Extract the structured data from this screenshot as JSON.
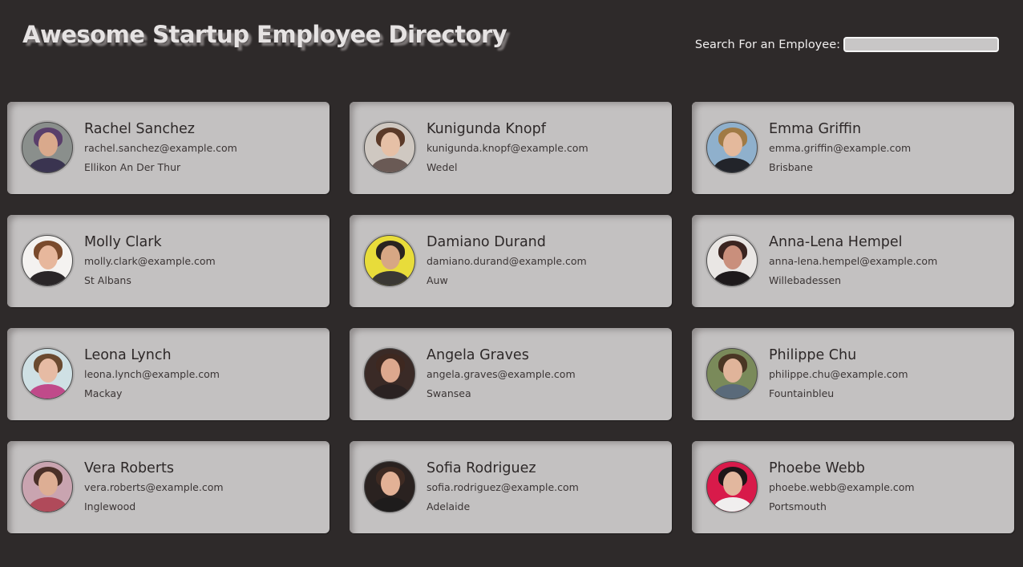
{
  "header": {
    "title": "Awesome Startup Employee Directory",
    "search_label": "Search For an Employee:",
    "search_value": "",
    "search_placeholder": ""
  },
  "employees": [
    {
      "name": "Rachel Sanchez",
      "email": "rachel.sanchez@example.com",
      "city": "Ellikon An Der Thur",
      "avatar": {
        "bg": "#8a8f8c",
        "hair": "#5a3f6b",
        "skin": "#d9a98c",
        "shirt": "#3a3450"
      }
    },
    {
      "name": "Kunigunda Knopf",
      "email": "kunigunda.knopf@example.com",
      "city": "Wedel",
      "avatar": {
        "bg": "#cfc8c1",
        "hair": "#5b3a28",
        "skin": "#e6c0a6",
        "shirt": "#6a5a55"
      }
    },
    {
      "name": "Emma Griffin",
      "email": "emma.griffin@example.com",
      "city": "Brisbane",
      "avatar": {
        "bg": "#8fb0cc",
        "hair": "#a07a45",
        "skin": "#e4b99c",
        "shirt": "#22242a"
      }
    },
    {
      "name": "Molly Clark",
      "email": "molly.clark@example.com",
      "city": "St Albans",
      "avatar": {
        "bg": "#f4f2f0",
        "hair": "#7a4a2c",
        "skin": "#e7b79c",
        "shirt": "#2a2628"
      }
    },
    {
      "name": "Damiano Durand",
      "email": "damiano.durand@example.com",
      "city": "Auw",
      "avatar": {
        "bg": "#e8dc3a",
        "hair": "#2a2420",
        "skin": "#d7a784",
        "shirt": "#3a3834"
      }
    },
    {
      "name": "Anna-Lena Hempel",
      "email": "anna-lena.hempel@example.com",
      "city": "Willebadessen",
      "avatar": {
        "bg": "#e9e6e4",
        "hair": "#3a2420",
        "skin": "#c98f7c",
        "shirt": "#1e1a1c"
      }
    },
    {
      "name": "Leona Lynch",
      "email": "leona.lynch@example.com",
      "city": "Mackay",
      "avatar": {
        "bg": "#cfe0e4",
        "hair": "#6a4a30",
        "skin": "#e6bba4",
        "shirt": "#c04a8a"
      }
    },
    {
      "name": "Angela Graves",
      "email": "angela.graves@example.com",
      "city": "Swansea",
      "avatar": {
        "bg": "#3a2a26",
        "hair": "#3e2820",
        "skin": "#dca88e",
        "shirt": "#2a2222"
      }
    },
    {
      "name": "Philippe Chu",
      "email": "philippe.chu@example.com",
      "city": "Fountainbleu",
      "avatar": {
        "bg": "#7a8a5a",
        "hair": "#4a3624",
        "skin": "#e0b49a",
        "shirt": "#5a6a7a"
      }
    },
    {
      "name": "Vera Roberts",
      "email": "vera.roberts@example.com",
      "city": "Inglewood",
      "avatar": {
        "bg": "#c9a4b0",
        "hair": "#4a3028",
        "skin": "#ddae94",
        "shirt": "#b04a5a"
      }
    },
    {
      "name": "Sofia Rodriguez",
      "email": "sofia.rodriguez@example.com",
      "city": "Adelaide",
      "avatar": {
        "bg": "#2a2220",
        "hair": "#3e2a22",
        "skin": "#e2b196",
        "shirt": "#1e1c1c"
      }
    },
    {
      "name": "Phoebe Webb",
      "email": "phoebe.webb@example.com",
      "city": "Portsmouth",
      "avatar": {
        "bg": "#d81a4a",
        "hair": "#1e1618",
        "skin": "#e2b79e",
        "shirt": "#f0eeee"
      }
    }
  ]
}
